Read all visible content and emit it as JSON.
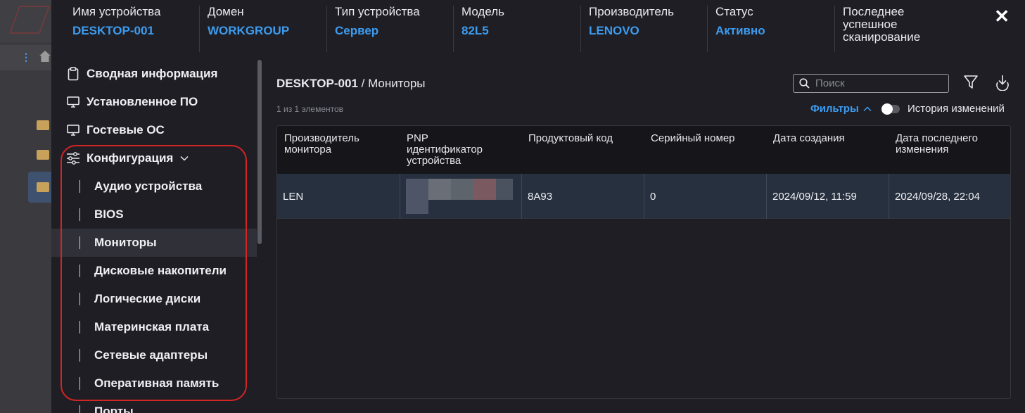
{
  "header": {
    "columns": [
      {
        "label": "Имя устройства",
        "value": "DESKTOP-001"
      },
      {
        "label": "Домен",
        "value": "WORKGROUP"
      },
      {
        "label": "Тип устройства",
        "value": "Сервер"
      },
      {
        "label": "Модель",
        "value": "82L5"
      },
      {
        "label": "Производитель",
        "value": "LENOVO"
      },
      {
        "label": "Статус",
        "value": "Активно"
      },
      {
        "label": "Последнее успешное сканирование",
        "value": ""
      }
    ],
    "close_icon": "close-icon"
  },
  "sidebar": {
    "items": [
      {
        "label": "Сводная информация",
        "icon": "clipboard-icon"
      },
      {
        "label": "Установленное ПО",
        "icon": "monitor-icon"
      },
      {
        "label": "Гостевые ОС",
        "icon": "monitor-icon"
      },
      {
        "label": "Конфигурация",
        "icon": "sliders-icon"
      }
    ],
    "sub_items": [
      {
        "label": "Аудио устройства"
      },
      {
        "label": "BIOS"
      },
      {
        "label": "Мониторы"
      },
      {
        "label": "Дисковые накопители"
      },
      {
        "label": "Логические диски"
      },
      {
        "label": "Материнская плата"
      },
      {
        "label": "Сетевые адаптеры"
      },
      {
        "label": "Оперативная память"
      },
      {
        "label": "Порты"
      }
    ],
    "active_sub_item": "Мониторы"
  },
  "main": {
    "breadcrumb_device": "DESKTOP-001",
    "breadcrumb_page": " / Мониторы",
    "search_placeholder": "Поиск",
    "count": "1 из 1 элементов",
    "filters_label": "Фильтры",
    "history_label": "История изменений",
    "history_enabled": false
  },
  "table": {
    "headers": [
      "Производитель монитора",
      "PNP идентификатор устройства",
      "Продуктовый код",
      "Серийный номер",
      "Дата создания",
      "Дата последнего изменения"
    ],
    "rows": [
      [
        "LEN",
        "",
        "8A93",
        "0",
        "2024/09/12, 11:59",
        "2024/09/28, 22:04"
      ]
    ]
  },
  "colors": {
    "accent": "#3d9cf0",
    "highlight_border": "#d42424",
    "row_bg": "#26303e"
  }
}
